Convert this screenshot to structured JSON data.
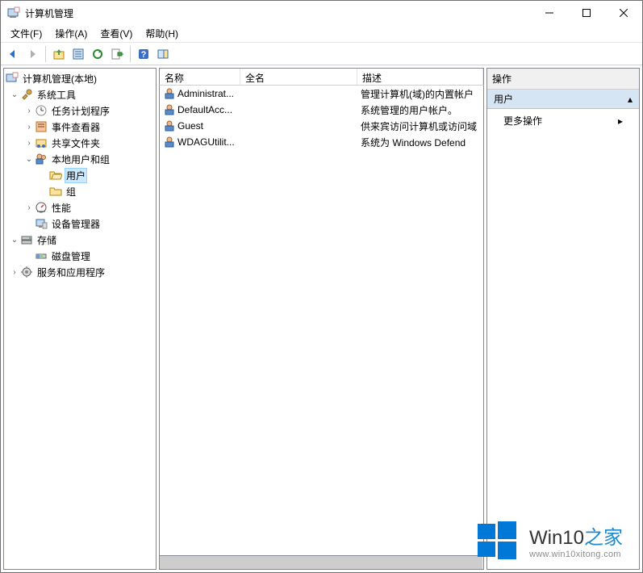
{
  "window": {
    "title": "计算机管理"
  },
  "menu": {
    "file": "文件(F)",
    "action": "操作(A)",
    "view": "查看(V)",
    "help": "帮助(H)"
  },
  "tree": {
    "root": "计算机管理(本地)",
    "systools": "系统工具",
    "scheduler": "任务计划程序",
    "eventviewer": "事件查看器",
    "shared": "共享文件夹",
    "localusers": "本地用户和组",
    "users": "用户",
    "groups": "组",
    "perf": "性能",
    "devmgr": "设备管理器",
    "storage": "存储",
    "diskmgr": "磁盘管理",
    "services": "服务和应用程序"
  },
  "list": {
    "headers": {
      "name": "名称",
      "fullname": "全名",
      "desc": "描述"
    },
    "rows": [
      {
        "name": "Administrat...",
        "fullname": "",
        "desc": "管理计算机(域)的内置帐户"
      },
      {
        "name": "DefaultAcc...",
        "fullname": "",
        "desc": "系统管理的用户帐户。"
      },
      {
        "name": "Guest",
        "fullname": "",
        "desc": "供来宾访问计算机或访问域"
      },
      {
        "name": "WDAGUtilit...",
        "fullname": "",
        "desc": "系统为 Windows Defend"
      }
    ]
  },
  "actions": {
    "title": "操作",
    "group": "用户",
    "more": "更多操作"
  },
  "watermark": {
    "brand": "Win10",
    "suffix": "之家",
    "url": "www.win10xitong.com"
  }
}
